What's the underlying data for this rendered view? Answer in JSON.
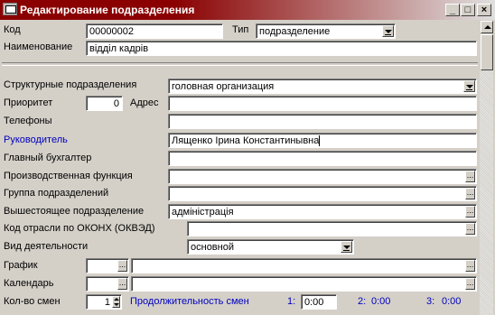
{
  "window": {
    "title": "Редактирование подразделения"
  },
  "fields": {
    "code": {
      "label": "Код",
      "value": "00000002"
    },
    "type": {
      "label": "Тип",
      "value": "подразделение"
    },
    "name": {
      "label": "Наименование",
      "value": "відділ кадрів"
    },
    "structural": {
      "label": "Структурные подразделения",
      "value": "головная организация"
    },
    "priority": {
      "label": "Приоритет",
      "value": "0"
    },
    "address": {
      "label": "Адрес",
      "value": ""
    },
    "phones": {
      "label": "Телефоны",
      "value": ""
    },
    "head": {
      "label": "Руководитель",
      "value": "Лященко Ірина Константинывна"
    },
    "accountant": {
      "label": "Главный бухгалтер",
      "value": ""
    },
    "function": {
      "label": "Производственная функция",
      "value": ""
    },
    "group": {
      "label": "Группа подразделений",
      "value": ""
    },
    "parent": {
      "label": "Вышестоящее подразделение",
      "value": "адміністрація"
    },
    "okonh": {
      "label": "Код отрасли по ОКОНХ (ОКВЭД)",
      "value": ""
    },
    "activity": {
      "label": "Вид деятельности",
      "value": "основной"
    },
    "schedule": {
      "label": "График",
      "code": "",
      "value": ""
    },
    "calendar": {
      "label": "Календарь",
      "code": "",
      "value": ""
    },
    "shifts": {
      "label": "Кол-во смен",
      "value": "1"
    },
    "duration": {
      "label": "Продолжительность смен",
      "s1_label": "1:",
      "s1_value": "0:00",
      "s2_label": "2:",
      "s2_value": "0:00",
      "s3_label": "3:",
      "s3_value": "0:00"
    }
  },
  "buttons": {
    "ellipsis": "...",
    "minimize": "_",
    "maximize": "□",
    "close": "×"
  }
}
